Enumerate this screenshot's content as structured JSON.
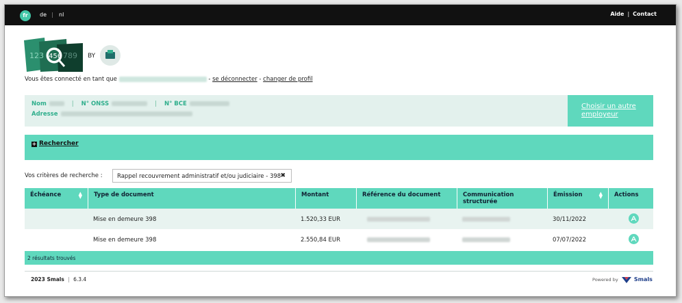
{
  "topbar": {
    "languages": [
      "fr",
      "de",
      "nl"
    ],
    "separator": "|",
    "links": [
      "Aide",
      "Contact"
    ]
  },
  "brand": {
    "by_label": "BY",
    "logo_icon": "magnifier-documents-logo",
    "partner_icon": "partner-logo"
  },
  "connection": {
    "prefix": "Vous êtes connecté en tant que",
    "sep1": "-",
    "logout": "se déconnecter",
    "sep2": "-",
    "change_profile": "changer de profil"
  },
  "employer": {
    "nom_label": "Nom",
    "onss_label": "N° ONSS",
    "bce_label": "N° BCE",
    "adresse_label": "Adresse",
    "field_sep": "|",
    "choose_label": "Choisir un autre employeur"
  },
  "search": {
    "toggle_label": "Rechercher",
    "criteria_label": "Vos critères de recherche :",
    "criteria_chip": "Rappel recouvrement administratif et/ou judiciaire - 398",
    "chip_remove": "✖"
  },
  "table": {
    "columns": [
      "Échéance",
      "Type de document",
      "Montant",
      "Référence du document",
      "Communication structurée",
      "Émission",
      "Actions"
    ],
    "rows": [
      {
        "echeance": "",
        "type": "Mise en demeure 398",
        "montant": "1.520,33 EUR",
        "emission": "30/11/2022",
        "action_icon": "pdf-icon"
      },
      {
        "echeance": "",
        "type": "Mise en demeure 398",
        "montant": "2.550,84 EUR",
        "emission": "07/07/2022",
        "action_icon": "pdf-icon"
      }
    ],
    "result_count": "2 résultats trouvés"
  },
  "footer": {
    "year_company": "2023 Smals",
    "separator": "|",
    "version": "6.3.4",
    "powered_by": "Powered by",
    "powered_name": "Smals"
  },
  "colors": {
    "accent": "#5fd8bd",
    "accent_dark": "#2fae8c",
    "panel_bg": "#e3f1ed",
    "topbar_bg": "#111111"
  }
}
